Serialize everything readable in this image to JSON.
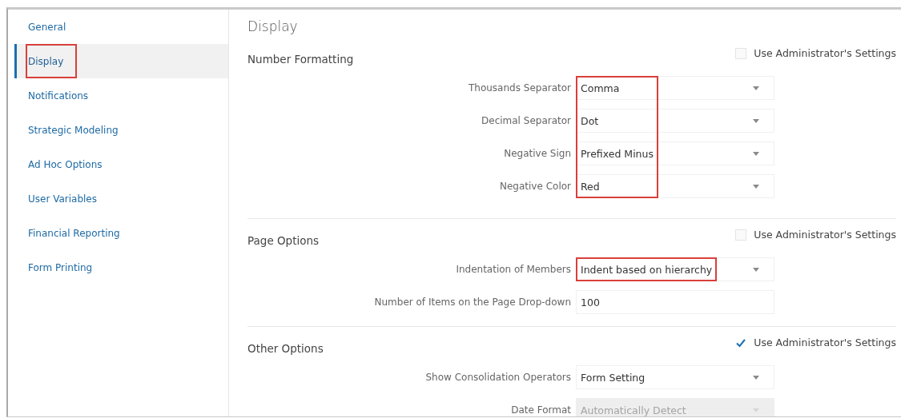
{
  "sidebar": {
    "items": [
      {
        "label": "General",
        "selected": false,
        "highlighted": false
      },
      {
        "label": "Display",
        "selected": true,
        "highlighted": true
      },
      {
        "label": "Notifications",
        "selected": false,
        "highlighted": false
      },
      {
        "label": "Strategic Modeling",
        "selected": false,
        "highlighted": false
      },
      {
        "label": "Ad Hoc Options",
        "selected": false,
        "highlighted": false
      },
      {
        "label": "User Variables",
        "selected": false,
        "highlighted": false
      },
      {
        "label": "Financial Reporting",
        "selected": false,
        "highlighted": false
      },
      {
        "label": "Form Printing",
        "selected": false,
        "highlighted": false
      }
    ]
  },
  "page_title": "Display",
  "sections": [
    {
      "title": "Number Formatting",
      "admin_checkbox": {
        "label": "Use Administrator's Settings",
        "checked": false
      },
      "fields": [
        {
          "label": "Thousands Separator",
          "kind": "dropdown",
          "value": "Comma",
          "disabled": false,
          "highlighted": true
        },
        {
          "label": "Decimal Separator",
          "kind": "dropdown",
          "value": "Dot",
          "disabled": false,
          "highlighted": true
        },
        {
          "label": "Negative Sign",
          "kind": "dropdown",
          "value": "Prefixed Minus",
          "disabled": false,
          "highlighted": true
        },
        {
          "label": "Negative Color",
          "kind": "dropdown",
          "value": "Red",
          "disabled": false,
          "highlighted": true
        }
      ]
    },
    {
      "title": "Page Options",
      "admin_checkbox": {
        "label": "Use Administrator's Settings",
        "checked": false
      },
      "fields": [
        {
          "label": "Indentation of Members",
          "kind": "dropdown",
          "value": "Indent based on hierarchy",
          "disabled": false,
          "highlighted": true
        },
        {
          "label": "Number of Items on the Page Drop-down",
          "kind": "text",
          "value": "100",
          "disabled": false,
          "highlighted": false
        }
      ]
    },
    {
      "title": "Other Options",
      "admin_checkbox": {
        "label": "Use Administrator's Settings",
        "checked": true
      },
      "fields": [
        {
          "label": "Show Consolidation Operators",
          "kind": "dropdown",
          "value": "Form Setting",
          "disabled": false,
          "highlighted": false
        },
        {
          "label": "Date Format",
          "kind": "dropdown",
          "value": "Automatically Detect",
          "disabled": true,
          "highlighted": false
        }
      ]
    }
  ]
}
